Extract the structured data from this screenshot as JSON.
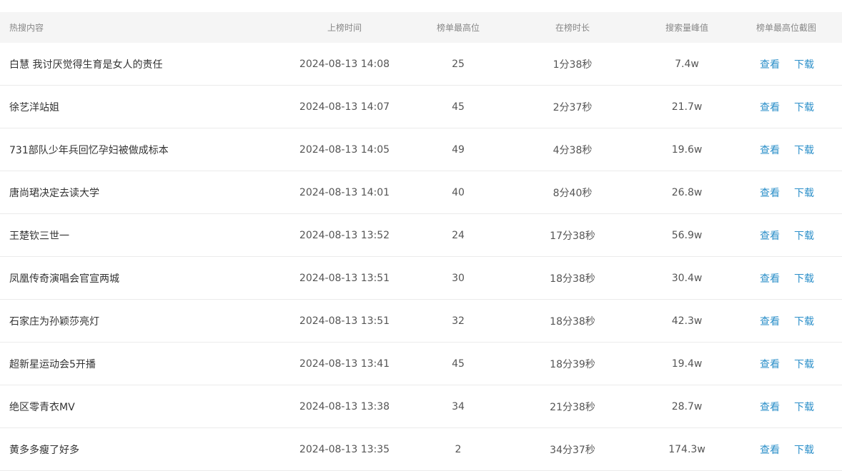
{
  "table": {
    "columns": {
      "title": "热搜内容",
      "time": "上榜时间",
      "rank": "榜单最高位",
      "duration": "在榜时长",
      "peak": "搜索量峰值",
      "screenshot": "榜单最高位截图"
    },
    "actions": {
      "view": "查看",
      "download": "下载"
    },
    "rows": [
      {
        "title": "白慧 我讨厌觉得生育是女人的责任",
        "time": "2024-08-13 14:08",
        "rank": "25",
        "duration": "1分38秒",
        "peak": "7.4w"
      },
      {
        "title": "徐艺洋站姐",
        "time": "2024-08-13 14:07",
        "rank": "45",
        "duration": "2分37秒",
        "peak": "21.7w"
      },
      {
        "title": "731部队少年兵回忆孕妇被做成标本",
        "time": "2024-08-13 14:05",
        "rank": "49",
        "duration": "4分38秒",
        "peak": "19.6w"
      },
      {
        "title": "唐尚珺决定去读大学",
        "time": "2024-08-13 14:01",
        "rank": "40",
        "duration": "8分40秒",
        "peak": "26.8w"
      },
      {
        "title": "王楚钦三世一",
        "time": "2024-08-13 13:52",
        "rank": "24",
        "duration": "17分38秒",
        "peak": "56.9w"
      },
      {
        "title": "凤凰传奇演唱会官宣两城",
        "time": "2024-08-13 13:51",
        "rank": "30",
        "duration": "18分38秒",
        "peak": "30.4w"
      },
      {
        "title": "石家庄为孙颖莎亮灯",
        "time": "2024-08-13 13:51",
        "rank": "32",
        "duration": "18分38秒",
        "peak": "42.3w"
      },
      {
        "title": "超新星运动会5开播",
        "time": "2024-08-13 13:41",
        "rank": "45",
        "duration": "18分39秒",
        "peak": "19.4w"
      },
      {
        "title": "绝区零青衣MV",
        "time": "2024-08-13 13:38",
        "rank": "34",
        "duration": "21分38秒",
        "peak": "28.7w"
      },
      {
        "title": "黄多多瘦了好多",
        "time": "2024-08-13 13:35",
        "rank": "2",
        "duration": "34分37秒",
        "peak": "174.3w"
      }
    ]
  }
}
